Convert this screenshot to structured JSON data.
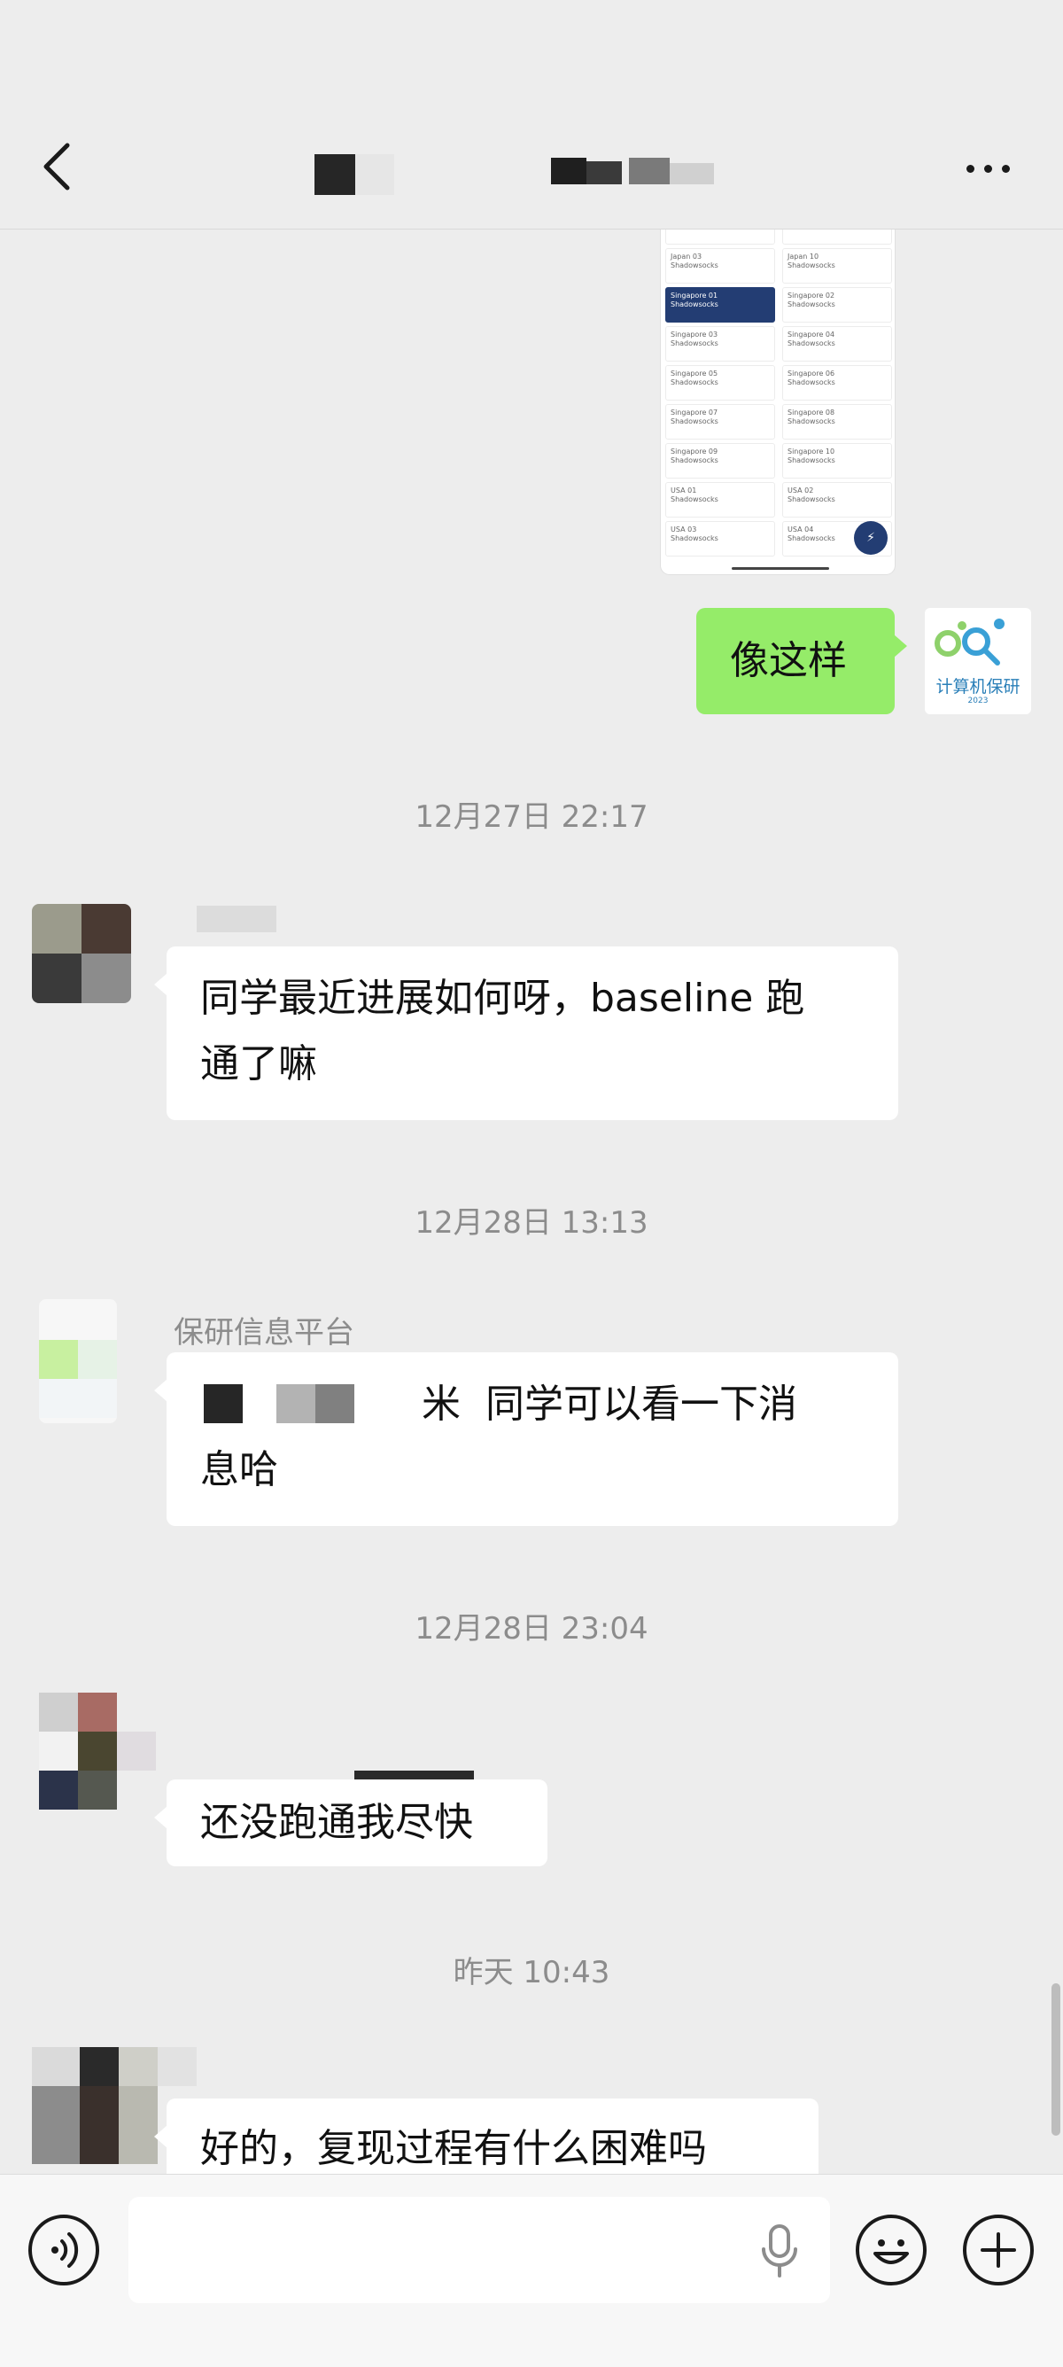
{
  "header": {
    "back_icon": "chevron-left-icon",
    "more_icon": "more-dots-icon"
  },
  "screenshot": {
    "cells": [
      [
        "",
        ""
      ],
      [
        "Japan 03",
        "Japan 10"
      ],
      [
        "Singapore 01",
        "Singapore 02"
      ],
      [
        "Singapore 03",
        "Singapore 04"
      ],
      [
        "Singapore 05",
        "Singapore 06"
      ],
      [
        "Singapore 07",
        "Singapore 08"
      ],
      [
        "Singapore 09",
        "Singapore 10"
      ],
      [
        "USA 01",
        "USA 02"
      ],
      [
        "USA 03",
        "USA 04"
      ]
    ],
    "cell_sub": "Shadowsocks"
  },
  "messages": {
    "m1": {
      "text": "像这样",
      "logo_text": "计算机保研",
      "logo_sub": "2023"
    },
    "ts1": "12月27日 22:17",
    "m2": {
      "text_line1": "同学最近进展如何呀，baseline 跑",
      "text_line2": "通了嘛"
    },
    "ts2": "12月28日 13:13",
    "m3": {
      "sender": "保研信息平台",
      "text_line1": "米  同学可以看一下消",
      "text_line2": "息哈"
    },
    "ts3": "12月28日 23:04",
    "m4": {
      "text": "还没跑通我尽快"
    },
    "ts4": "昨天 10:43",
    "m5": {
      "text": "好的，复现过程有什么困难吗"
    }
  },
  "input_bar": {
    "voice_icon": "voice-toggle-icon",
    "mic_icon": "microphone-icon",
    "emoji_icon": "emoji-icon",
    "plus_icon": "plus-icon",
    "value": "",
    "placeholder": ""
  },
  "colors": {
    "background": "#ededed",
    "incoming_bubble": "#ffffff",
    "outgoing_bubble": "#95ec69",
    "timestamp": "#8c8c8c"
  }
}
